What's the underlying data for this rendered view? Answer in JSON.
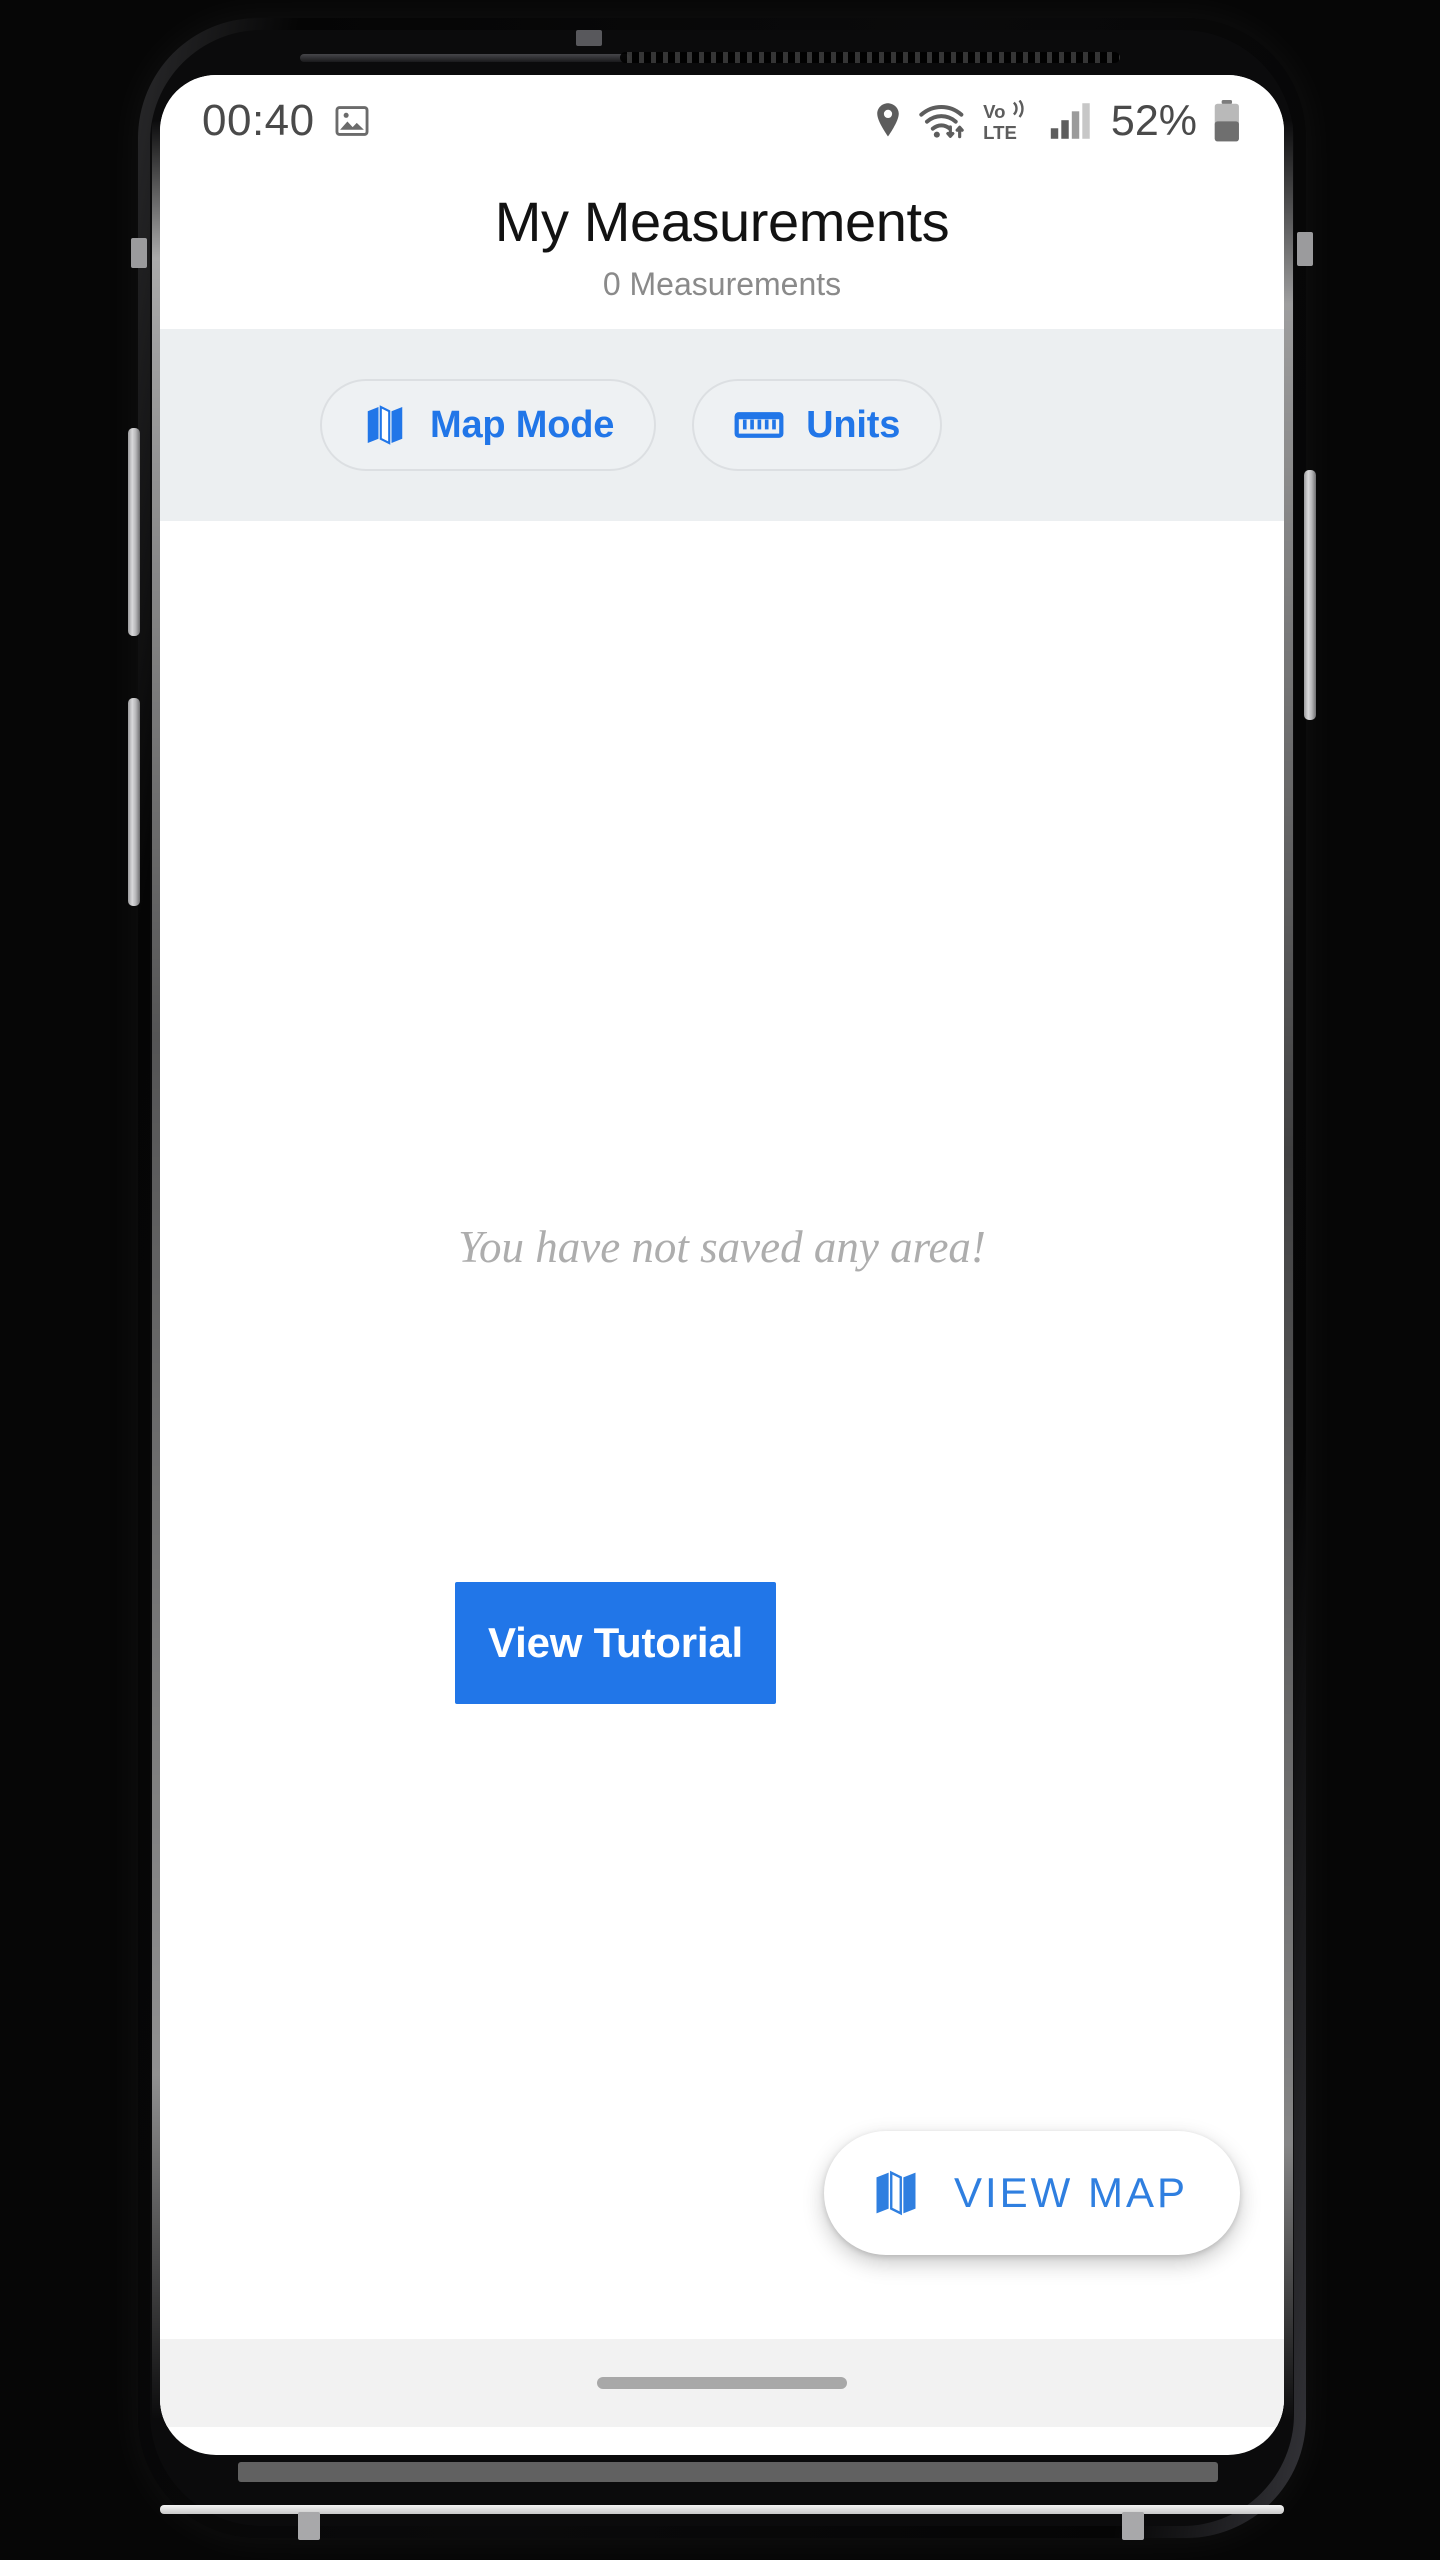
{
  "status_bar": {
    "clock": "00:40",
    "battery_percent": "52%",
    "network_label_top": "Vo)",
    "network_label_bottom": "LTE",
    "icons": [
      "photo-icon",
      "location-pin-icon",
      "wifi-icon",
      "volte-icon",
      "signal-bars-icon",
      "battery-icon"
    ]
  },
  "header": {
    "title": "My Measurements",
    "subtitle": "0 Measurements"
  },
  "toolbar": {
    "chips": [
      {
        "label": "Map Mode",
        "icon": "map-icon"
      },
      {
        "label": "Units",
        "icon": "ruler-icon"
      }
    ]
  },
  "content": {
    "empty_message": "You have not saved any area!",
    "tutorial_button": "View Tutorial"
  },
  "fab": {
    "label": "VIEW MAP",
    "icon": "map-icon"
  },
  "colors": {
    "accent_blue": "#2176e8",
    "fab_blue": "#2f7fe0",
    "toolbar_band": "#eceff1",
    "empty_text": "#adadad",
    "nav_bar": "#f2f2f2"
  }
}
